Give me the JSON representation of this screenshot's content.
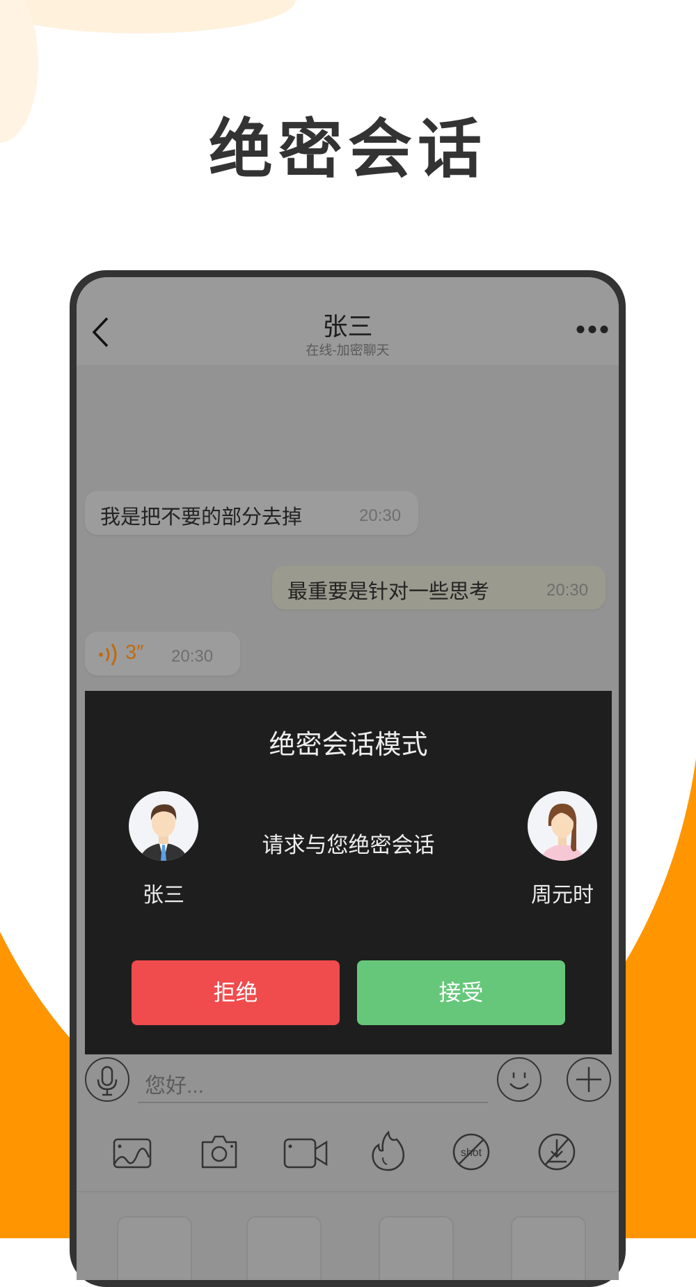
{
  "headline": "绝密会话",
  "colors": {
    "accent_orange": "#ff9500",
    "peach": "#fff1dc",
    "reject": "#f04b4d",
    "accept": "#66c77a",
    "dialog_bg": "#1e1e1e"
  },
  "chat_header": {
    "back_icon": "chevron-left-icon",
    "contact_name": "张三",
    "status": "在线-加密聊天",
    "more_icon": "more-dots-icon"
  },
  "messages": [
    {
      "side": "left",
      "text": "我是把不要的部分去掉",
      "time": "20:30"
    },
    {
      "side": "right",
      "text": "最重要是针对一些思考",
      "time": "20:30"
    },
    {
      "side": "left",
      "type": "voice",
      "duration": "3″",
      "time": "20:30"
    }
  ],
  "dialog": {
    "title": "绝密会话模式",
    "message": "请求与您绝密会话",
    "caller": {
      "name": "张三",
      "avatar": "male-avatar"
    },
    "callee": {
      "name": "周元时",
      "avatar": "female-avatar"
    },
    "reject_label": "拒绝",
    "accept_label": "接受"
  },
  "composer": {
    "placeholder": "您好...",
    "voice_icon": "microphone-icon",
    "emoji_icon": "smiley-icon",
    "plus_icon": "plus-icon"
  },
  "toolbar": {
    "icons": [
      "image-icon",
      "camera-icon",
      "video-icon",
      "burn-after-read-icon",
      "no-screenshot-icon",
      "no-download-icon"
    ],
    "shot_label": "shot"
  }
}
